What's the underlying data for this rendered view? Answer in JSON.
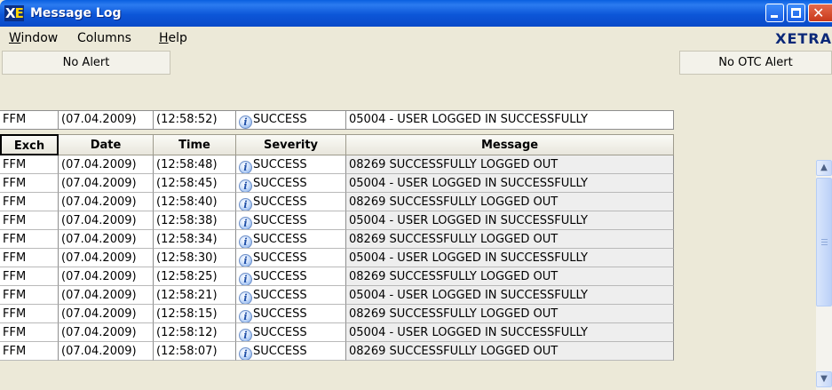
{
  "window": {
    "title": "Message Log",
    "app_icon_text_x": "X",
    "app_icon_text_e": "E",
    "minimize_glyph": "",
    "close_glyph": "✕"
  },
  "menu": {
    "items": [
      {
        "label": "Window",
        "underline": "W"
      },
      {
        "label": "Columns",
        "underline": ""
      },
      {
        "label": "Help",
        "underline": "H"
      }
    ],
    "brand": "XETRA"
  },
  "alerts": {
    "left": "No Alert",
    "right": "No OTC Alert"
  },
  "latest": {
    "exch": "FFM",
    "date": "(07.04.2009)",
    "time": "(12:58:52)",
    "severity": "SUCCESS",
    "message": "05004 - USER LOGGED IN SUCCESSFULLY"
  },
  "table": {
    "columns": [
      "Exch",
      "Date",
      "Time",
      "Severity",
      "Message"
    ],
    "rows": [
      {
        "exch": "FFM",
        "date": "(07.04.2009)",
        "time": "(12:58:48)",
        "severity": "SUCCESS",
        "message": "08269 SUCCESSFULLY LOGGED OUT"
      },
      {
        "exch": "FFM",
        "date": "(07.04.2009)",
        "time": "(12:58:45)",
        "severity": "SUCCESS",
        "message": "05004 - USER LOGGED IN SUCCESSFULLY"
      },
      {
        "exch": "FFM",
        "date": "(07.04.2009)",
        "time": "(12:58:40)",
        "severity": "SUCCESS",
        "message": "08269 SUCCESSFULLY LOGGED OUT"
      },
      {
        "exch": "FFM",
        "date": "(07.04.2009)",
        "time": "(12:58:38)",
        "severity": "SUCCESS",
        "message": "05004 - USER LOGGED IN SUCCESSFULLY"
      },
      {
        "exch": "FFM",
        "date": "(07.04.2009)",
        "time": "(12:58:34)",
        "severity": "SUCCESS",
        "message": "08269 SUCCESSFULLY LOGGED OUT"
      },
      {
        "exch": "FFM",
        "date": "(07.04.2009)",
        "time": "(12:58:30)",
        "severity": "SUCCESS",
        "message": "05004 - USER LOGGED IN SUCCESSFULLY"
      },
      {
        "exch": "FFM",
        "date": "(07.04.2009)",
        "time": "(12:58:25)",
        "severity": "SUCCESS",
        "message": "08269 SUCCESSFULLY LOGGED OUT"
      },
      {
        "exch": "FFM",
        "date": "(07.04.2009)",
        "time": "(12:58:21)",
        "severity": "SUCCESS",
        "message": "05004 - USER LOGGED IN SUCCESSFULLY"
      },
      {
        "exch": "FFM",
        "date": "(07.04.2009)",
        "time": "(12:58:15)",
        "severity": "SUCCESS",
        "message": "08269 SUCCESSFULLY LOGGED OUT"
      },
      {
        "exch": "FFM",
        "date": "(07.04.2009)",
        "time": "(12:58:12)",
        "severity": "SUCCESS",
        "message": "05004 - USER LOGGED IN SUCCESSFULLY"
      },
      {
        "exch": "FFM",
        "date": "(07.04.2009)",
        "time": "(12:58:07)",
        "severity": "SUCCESS",
        "message": "08269 SUCCESSFULLY LOGGED OUT"
      }
    ]
  },
  "icons": {
    "severity_icon": "info-icon",
    "severity_glyph": "i",
    "scroll_up_glyph": "▲",
    "scroll_down_glyph": "▼"
  },
  "colors": {
    "titlebar": "#0a5fe0",
    "brand": "#0b2878",
    "window_bg": "#ece9d8"
  }
}
